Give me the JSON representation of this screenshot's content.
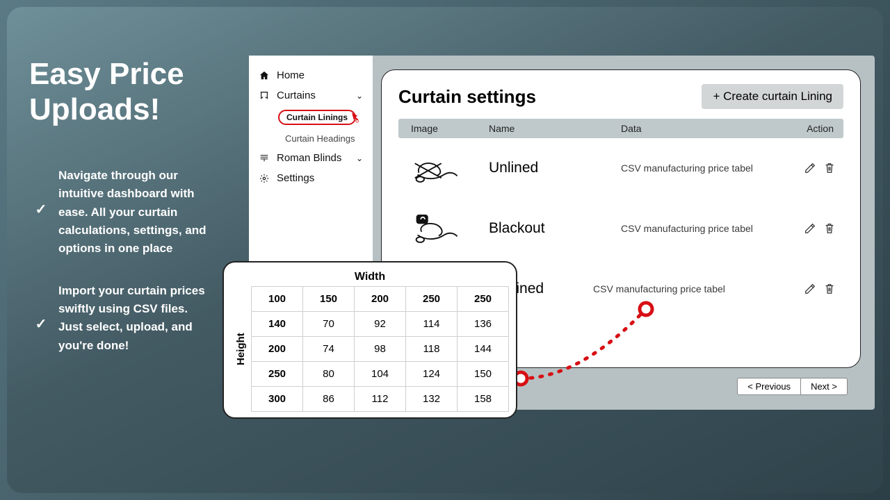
{
  "hero": {
    "title_line1": "Easy Price",
    "title_line2": "Uploads!",
    "bullets": [
      "Navigate through our intuitive dashboard with ease. All your curtain calculations, settings, and options in one place",
      "Import your curtain prices swiftly using CSV files. Just select, upload, and you're done!"
    ]
  },
  "sidebar": {
    "items": [
      {
        "label": "Home",
        "icon": "home"
      },
      {
        "label": "Curtains",
        "icon": "curtains",
        "expandable": true
      },
      {
        "label": "Curtain Linings",
        "sub": true,
        "active": true
      },
      {
        "label": "Curtain Headings",
        "sub": true
      },
      {
        "label": "Roman Blinds",
        "icon": "blinds",
        "expandable": true
      },
      {
        "label": "Settings",
        "icon": "gear"
      }
    ]
  },
  "panel": {
    "title": "Curtain settings",
    "create_label": "+ Create curtain Lining",
    "columns": {
      "image": "Image",
      "name": "Name",
      "data": "Data",
      "action": "Action"
    },
    "rows": [
      {
        "name": "Unlined",
        "data": "CSV manufacturing price tabel"
      },
      {
        "name": "Blackout",
        "data": "CSV manufacturing price tabel"
      },
      {
        "name": "Cotton Lined",
        "data": "CSV manufacturing price tabel"
      }
    ],
    "pager": {
      "prev": "< Previous",
      "next": "Next >"
    }
  },
  "chart_data": {
    "type": "table",
    "title_top": "Width",
    "title_left": "Height",
    "col_headers": [
      100,
      150,
      200,
      250,
      250
    ],
    "row_headers": [
      140,
      200,
      250,
      300
    ],
    "values": [
      [
        70,
        92,
        114,
        136
      ],
      [
        74,
        98,
        118,
        144
      ],
      [
        80,
        104,
        124,
        150
      ],
      [
        86,
        112,
        132,
        158
      ]
    ]
  }
}
